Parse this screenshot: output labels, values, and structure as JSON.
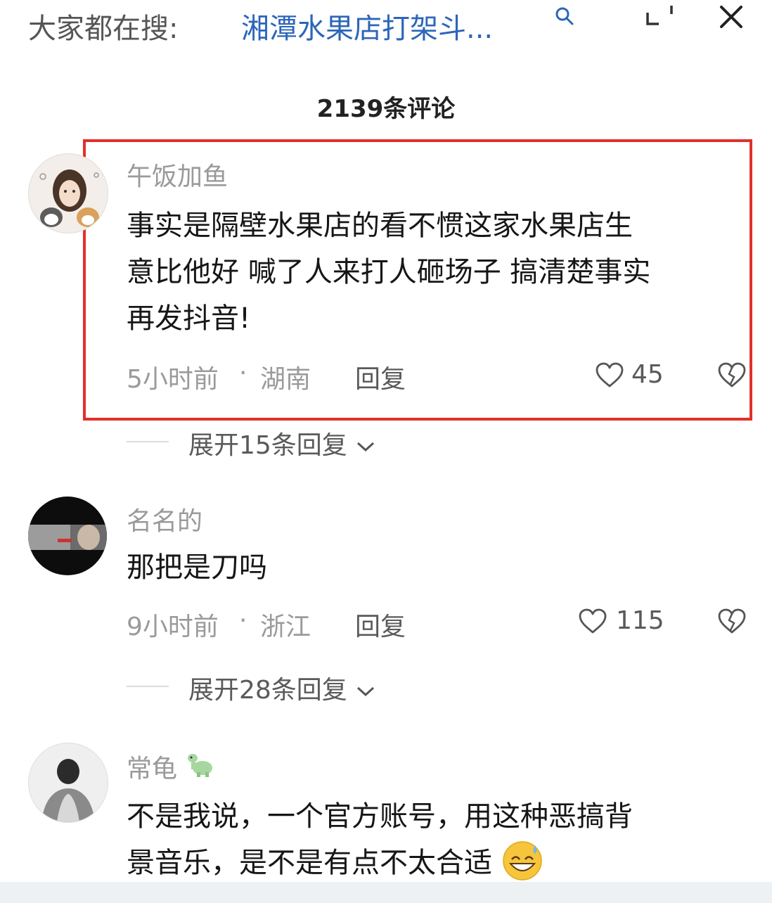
{
  "search_bar": {
    "prefix": "大家都在搜:",
    "term": "湘潭水果店打架斗..."
  },
  "comments_header": {
    "count_label": "2139条评论"
  },
  "comments": [
    {
      "username": "午饭加鱼",
      "lines": [
        "事实是隔壁水果店的看不惯这家水果店生",
        "意比他好 喊了人来打人砸场子 搞清楚事实",
        "再发抖音!"
      ],
      "time": "5小时前",
      "location": "湖南",
      "reply_label": "回复",
      "likes": "45",
      "expand_label": "展开15条回复",
      "highlighted": true
    },
    {
      "username": "名名的",
      "lines": [
        "那把是刀吗"
      ],
      "time": "9小时前",
      "location": "浙江",
      "reply_label": "回复",
      "likes": "115",
      "expand_label": "展开28条回复",
      "highlighted": false
    },
    {
      "username": "常龟",
      "lines": [
        "不是我说，一个官方账号，用这种恶搞背",
        "景音乐，是不是有点不太合适"
      ],
      "highlighted": false
    }
  ],
  "icons": {
    "search": "search-icon",
    "shrink": "shrink-icon",
    "close": "close-icon",
    "like": "heart-outline-icon",
    "dislike": "broken-heart-icon",
    "expand": "chevron-down-icon",
    "username_badge": "dinosaur-emoji-icon",
    "emoji": "grinning-sweat-emoji-icon"
  },
  "colors": {
    "search_term": "#2c66b8",
    "highlight_border": "#e0302a",
    "muted_text": "#9a9a9a"
  }
}
